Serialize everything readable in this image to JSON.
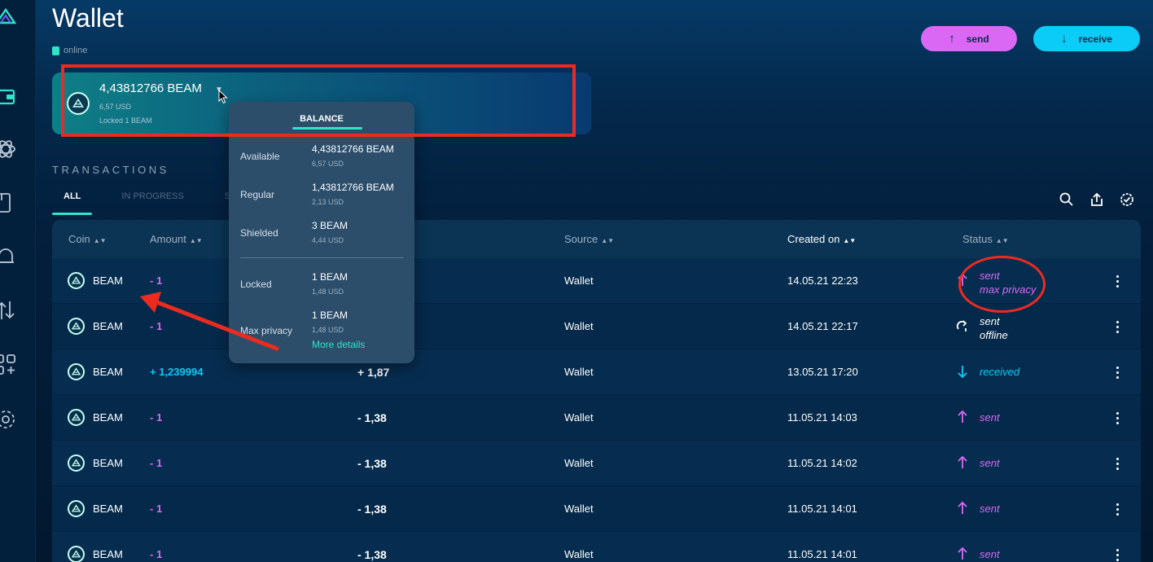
{
  "page": {
    "title": "Wallet",
    "status": "online"
  },
  "actions": {
    "send": "send",
    "receive": "receive"
  },
  "asset": {
    "amount": "4,43812766  BEAM",
    "usd": "6,57 USD",
    "locked": "Locked  1  BEAM"
  },
  "transactions": {
    "title": "TRANSACTIONS",
    "tabs": [
      "ALL",
      "IN PROGRESS",
      "SENT"
    ],
    "columns": {
      "coin": "Coin",
      "amount": "Amount",
      "source": "Source",
      "created": "Created on",
      "status": "Status"
    },
    "rows": [
      {
        "coin": "BEAM",
        "amount": "- 1",
        "usd": "",
        "source": "Wallet",
        "created": "14.05.21 22:23",
        "status1": "sent",
        "status2": "max privacy"
      },
      {
        "coin": "BEAM",
        "amount": "- 1",
        "usd": "",
        "source": "Wallet",
        "created": "14.05.21 22:17",
        "status1": "sent",
        "status2": "offline"
      },
      {
        "coin": "BEAM",
        "amount": "+ 1,239994",
        "usd": "+ 1,87",
        "source": "Wallet",
        "created": "13.05.21 17:20",
        "status1": "received",
        "status2": ""
      },
      {
        "coin": "BEAM",
        "amount": "- 1",
        "usd": "- 1,38",
        "source": "Wallet",
        "created": "11.05.21 14:03",
        "status1": "sent",
        "status2": ""
      },
      {
        "coin": "BEAM",
        "amount": "- 1",
        "usd": "- 1,38",
        "source": "Wallet",
        "created": "11.05.21 14:02",
        "status1": "sent",
        "status2": ""
      },
      {
        "coin": "BEAM",
        "amount": "- 1",
        "usd": "- 1,38",
        "source": "Wallet",
        "created": "11.05.21 14:01",
        "status1": "sent",
        "status2": ""
      },
      {
        "coin": "BEAM",
        "amount": "- 1",
        "usd": "- 1,38",
        "source": "Wallet",
        "created": "11.05.21 14:01",
        "status1": "sent",
        "status2": ""
      }
    ]
  },
  "balance_popup": {
    "tab": "BALANCE",
    "items": [
      {
        "label": "Available",
        "value": "4,43812766  BEAM",
        "usd": "6,57 USD"
      },
      {
        "label": "Regular",
        "value": "1,43812766  BEAM",
        "usd": "2,13 USD"
      },
      {
        "label": "Shielded",
        "value": "3  BEAM",
        "usd": "4,44 USD"
      },
      {
        "label": "Locked",
        "value": "1  BEAM",
        "usd": "1,48 USD"
      },
      {
        "label": "Max privacy",
        "value": "1  BEAM",
        "usd": "1,48 USD"
      }
    ],
    "more": "More details"
  },
  "colors": {
    "accent": "#2fe4c9",
    "send": "#da68f5",
    "receive": "#0bccf7",
    "annotation": "#ec2b1f"
  }
}
